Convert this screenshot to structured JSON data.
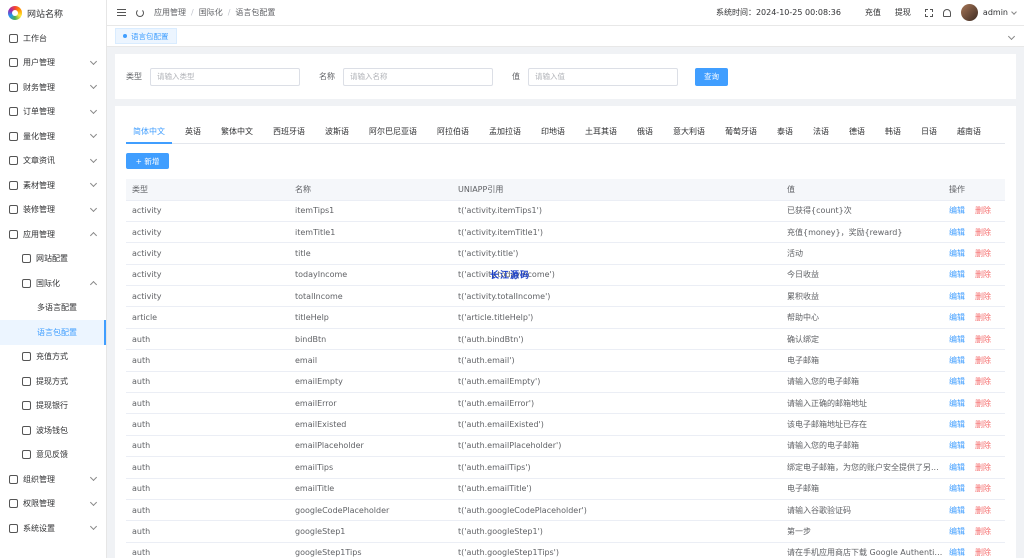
{
  "brand": {
    "name": "网站名称"
  },
  "sidebar": {
    "items": [
      {
        "label": "工作台",
        "icon": "monitor-icon",
        "chevron": false,
        "level": 0
      },
      {
        "label": "用户管理",
        "icon": "user-icon",
        "chevron": true,
        "level": 0
      },
      {
        "label": "财务管理",
        "icon": "finance-icon",
        "chevron": true,
        "level": 0
      },
      {
        "label": "订单管理",
        "icon": "order-icon",
        "chevron": true,
        "level": 0
      },
      {
        "label": "量化管理",
        "icon": "quant-icon",
        "chevron": true,
        "level": 0
      },
      {
        "label": "文章资讯",
        "icon": "article-icon",
        "chevron": true,
        "level": 0
      },
      {
        "label": "素材管理",
        "icon": "image-icon",
        "chevron": true,
        "level": 0
      },
      {
        "label": "装修管理",
        "icon": "decor-icon",
        "chevron": true,
        "level": 0
      },
      {
        "label": "应用管理",
        "icon": "app-icon",
        "chevron": true,
        "level": 0,
        "open": true
      },
      {
        "label": "网站配置",
        "icon": "gear-icon",
        "chevron": false,
        "level": 1
      },
      {
        "label": "国际化",
        "icon": "globe-icon",
        "chevron": true,
        "level": 1,
        "open": true
      },
      {
        "label": "多语言配置",
        "icon": "",
        "chevron": false,
        "level": 2
      },
      {
        "label": "语言包配置",
        "icon": "",
        "chevron": false,
        "level": 2,
        "active": true
      },
      {
        "label": "充值方式",
        "icon": "wallet-icon",
        "chevron": false,
        "level": 1
      },
      {
        "label": "提现方式",
        "icon": "folder-icon",
        "chevron": false,
        "level": 1
      },
      {
        "label": "提现银行",
        "icon": "bank-icon",
        "chevron": false,
        "level": 1
      },
      {
        "label": "波场钱包",
        "icon": "tron-wallet-icon",
        "chevron": false,
        "level": 1
      },
      {
        "label": "意见反馈",
        "icon": "feedback-icon",
        "chevron": false,
        "level": 1
      },
      {
        "label": "组织管理",
        "icon": "org-icon",
        "chevron": true,
        "level": 0
      },
      {
        "label": "权限管理",
        "icon": "lock-icon",
        "chevron": true,
        "level": 0
      },
      {
        "label": "系统设置",
        "icon": "settings-icon",
        "chevron": true,
        "level": 0
      }
    ]
  },
  "header": {
    "breadcrumb": [
      "应用管理",
      "国际化",
      "语言包配置"
    ],
    "system_time": "系统时间：2024-10-25 00:08:36",
    "recharge": "充值",
    "withdraw": "提现",
    "username": "admin"
  },
  "tags": {
    "active": "语言包配置"
  },
  "search": {
    "type_label": "类型",
    "type_placeholder": "请输入类型",
    "name_label": "名称",
    "name_placeholder": "请输入名称",
    "value_label": "值",
    "value_placeholder": "请输入值",
    "query_button": "查询"
  },
  "tabs": [
    "简体中文",
    "英语",
    "繁体中文",
    "西班牙语",
    "波斯语",
    "阿尔巴尼亚语",
    "阿拉伯语",
    "孟加拉语",
    "印地语",
    "土耳其语",
    "俄语",
    "意大利语",
    "葡萄牙语",
    "泰语",
    "法语",
    "德语",
    "韩语",
    "日语",
    "越南语"
  ],
  "add_button": "+ 新增",
  "table": {
    "headers": [
      "类型",
      "名称",
      "UNIAPP引用",
      "值",
      "操作"
    ],
    "edit_label": "编辑",
    "delete_label": "删除",
    "rows": [
      [
        "activity",
        "itemTips1",
        "t('activity.itemTips1')",
        "已获得{count}次"
      ],
      [
        "activity",
        "itemTitle1",
        "t('activity.itemTitle1')",
        "充值{money}，奖励{reward}"
      ],
      [
        "activity",
        "title",
        "t('activity.title')",
        "活动"
      ],
      [
        "activity",
        "todayIncome",
        "t('activity.todayIncome')",
        "今日收益"
      ],
      [
        "activity",
        "totalIncome",
        "t('activity.totalIncome')",
        "累积收益"
      ],
      [
        "article",
        "titleHelp",
        "t('article.titleHelp')",
        "帮助中心"
      ],
      [
        "auth",
        "bindBtn",
        "t('auth.bindBtn')",
        "确认绑定"
      ],
      [
        "auth",
        "email",
        "t('auth.email')",
        "电子邮箱"
      ],
      [
        "auth",
        "emailEmpty",
        "t('auth.emailEmpty')",
        "请输入您的电子邮箱"
      ],
      [
        "auth",
        "emailError",
        "t('auth.emailError')",
        "请输入正确的邮箱地址"
      ],
      [
        "auth",
        "emailExisted",
        "t('auth.emailExisted')",
        "该电子邮箱地址已存在"
      ],
      [
        "auth",
        "emailPlaceholder",
        "t('auth.emailPlaceholder')",
        "请输入您的电子邮箱"
      ],
      [
        "auth",
        "emailTips",
        "t('auth.emailTips')",
        "绑定电子邮箱，为您的账户安全提供了另..."
      ],
      [
        "auth",
        "emailTitle",
        "t('auth.emailTitle')",
        "电子邮箱"
      ],
      [
        "auth",
        "googleCodePlaceholder",
        "t('auth.googleCodePlaceholder')",
        "请输入谷歌验证码"
      ],
      [
        "auth",
        "googleStep1",
        "t('auth.googleStep1')",
        "第一步"
      ],
      [
        "auth",
        "googleStep1Tips",
        "t('auth.googleStep1Tips')",
        "请在手机应用商店下载 Google Authentica..."
      ]
    ]
  },
  "watermark": "长江源码",
  "colors": {
    "primary": "#409eff",
    "danger": "#f56c6c"
  }
}
